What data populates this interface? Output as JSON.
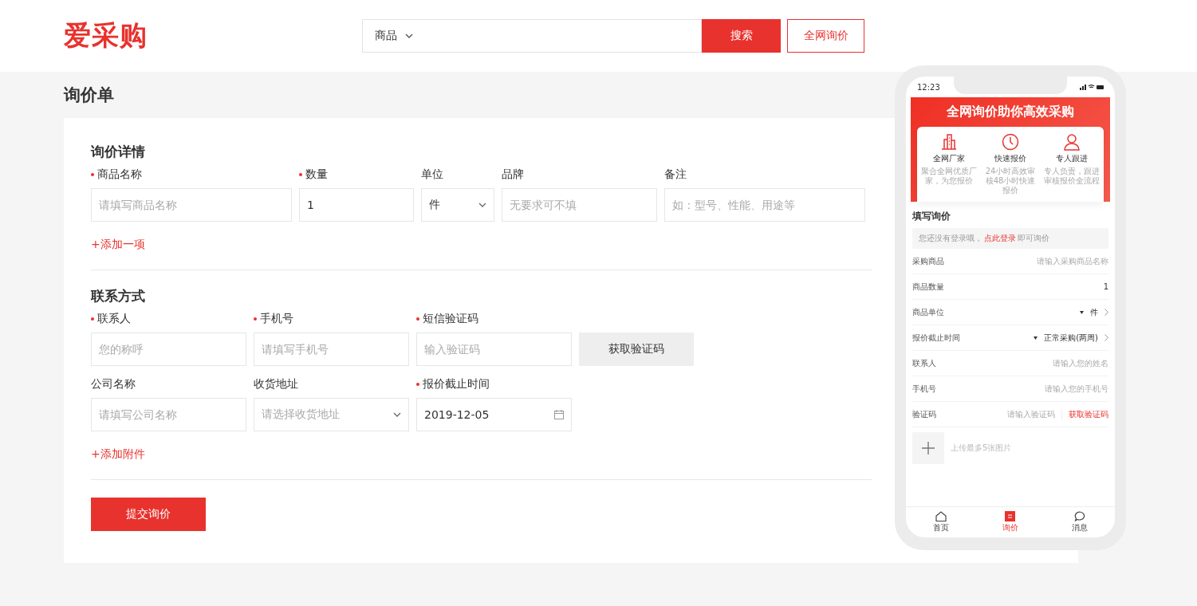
{
  "header": {
    "logo": "爱采购",
    "search": {
      "category": "商品",
      "button": "搜索"
    },
    "inquiry_button": "全网询价"
  },
  "page_title": "询价单",
  "form": {
    "sections": [
      {
        "title": "询价详情",
        "rows": [
          [
            {
              "kind": "input",
              "label": "商品名称",
              "required": true,
              "placeholder": "请填写商品名称"
            },
            {
              "kind": "input",
              "label": "数量",
              "required": true,
              "value": "1"
            },
            {
              "kind": "select",
              "label": "单位",
              "required": false,
              "value": "件"
            },
            {
              "kind": "input",
              "label": "品牌",
              "required": false,
              "placeholder": "无要求可不填"
            },
            {
              "kind": "input",
              "label": "备注",
              "required": false,
              "placeholder": "如：型号、性能、用途等"
            }
          ]
        ],
        "add_link": "+添加一项"
      },
      {
        "title": "联系方式",
        "rows": [
          [
            {
              "kind": "input",
              "label": "联系人",
              "required": true,
              "placeholder": "您的称呼"
            },
            {
              "kind": "input",
              "label": "手机号",
              "required": true,
              "placeholder": "请填写手机号"
            },
            {
              "kind": "input",
              "label": "短信验证码",
              "required": true,
              "placeholder": "输入验证码"
            },
            {
              "kind": "button",
              "text": "获取验证码"
            }
          ],
          [
            {
              "kind": "input",
              "label": "公司名称",
              "required": false,
              "placeholder": "请填写公司名称"
            },
            {
              "kind": "select",
              "label": "收货地址",
              "required": false,
              "placeholder": "请选择收货地址"
            },
            {
              "kind": "date",
              "label": "报价截止时间",
              "required": true,
              "value": "2019-12-05"
            }
          ]
        ],
        "add_link": "+添加附件"
      }
    ],
    "submit": "提交询价"
  },
  "phone": {
    "time": "12:23",
    "banner": {
      "title": "全网询价助你高效采购",
      "features": [
        {
          "title": "全网厂家",
          "desc": "聚合全网优质厂家，为您报价"
        },
        {
          "title": "快速报价",
          "desc": "24小时高效审核48小时快速报价"
        },
        {
          "title": "专人跟进",
          "desc": "专人负责，跟进审核报价全流程"
        }
      ]
    },
    "form_title": "填写询价",
    "login_notice": {
      "before": "您还没有登录哦，",
      "link": "点此登录",
      "after": "即可询价"
    },
    "rows": [
      {
        "kind": "input",
        "label": "采购商品",
        "placeholder": "请输入采购商品名称"
      },
      {
        "kind": "input",
        "label": "商品数量",
        "value": "1"
      },
      {
        "kind": "select",
        "label": "商品单位",
        "value": "件"
      },
      {
        "kind": "select",
        "label": "报价截止时间",
        "value": "正常采购(两周)"
      },
      {
        "kind": "input",
        "label": "联系人",
        "placeholder": "请输入您的姓名"
      },
      {
        "kind": "input",
        "label": "手机号",
        "placeholder": "请输入您的手机号"
      },
      {
        "kind": "code",
        "label": "验证码",
        "placeholder": "请输入验证码",
        "button": "获取验证码"
      }
    ],
    "upload_hint": "上传最多5张图片",
    "tabs": [
      {
        "label": "首页",
        "selected": false
      },
      {
        "label": "询价",
        "selected": true
      },
      {
        "label": "消息",
        "selected": false
      }
    ]
  }
}
